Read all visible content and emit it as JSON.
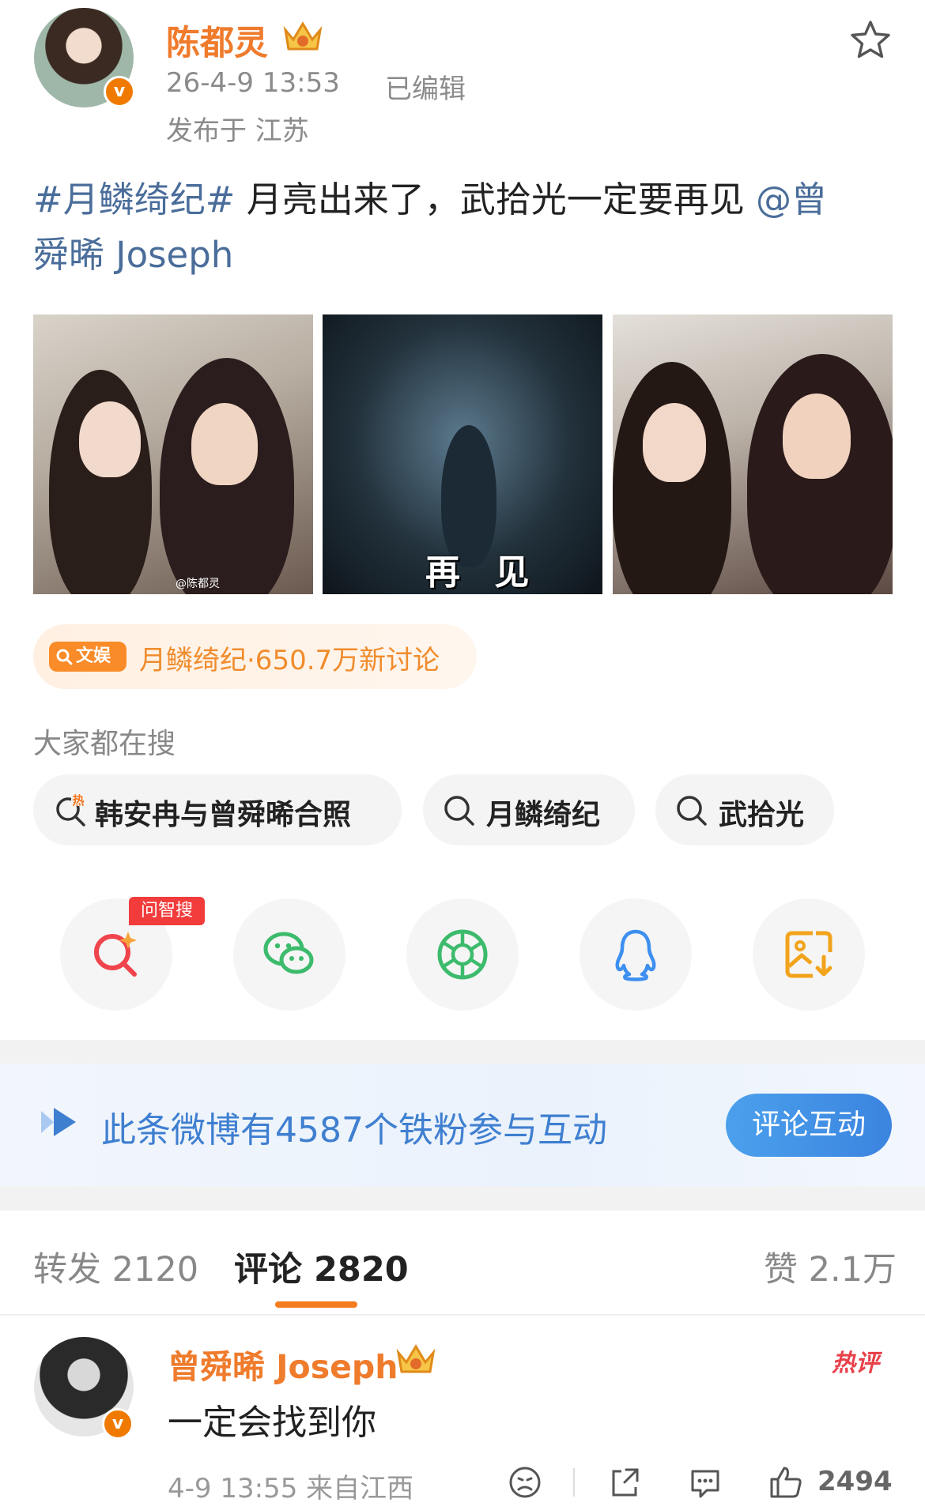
{
  "post": {
    "author": "陈都灵",
    "time": "26-4-9 13:53",
    "edited": "已编辑",
    "location": "发布于 江苏",
    "hashtag": "#月鳞绮纪#",
    "text": " 月亮出来了，武拾光一定要再见 ",
    "mention_line1": "@曾",
    "mention_line2": "舜晞 Joseph",
    "image_watermark": "@陈都灵",
    "image_caption": "再 见"
  },
  "topic": {
    "tag": "文娱",
    "text": "月鳞绮纪·650.7万新讨论"
  },
  "search": {
    "title": "大家都在搜",
    "chips": [
      {
        "label": "韩安冉与曾舜晞合照",
        "icon": "hot-search-icon"
      },
      {
        "label": "月鳞绮纪",
        "icon": "search-icon"
      },
      {
        "label": "武拾光",
        "icon": "search-icon"
      }
    ]
  },
  "share": {
    "wzs_badge": "问智搜",
    "buttons": [
      "ask-search-icon",
      "wechat-icon",
      "moments-icon",
      "qq-icon",
      "save-image-icon"
    ]
  },
  "fans": {
    "text": "此条微博有4587个铁粉参与互动",
    "button": "评论互动"
  },
  "tabs": {
    "repost_label": "转发",
    "repost_count": "2120",
    "comment_label": "评论",
    "comment_count": "2820",
    "like_label": "赞",
    "like_count": "2.1万"
  },
  "comment": {
    "author": "曾舜晞 Joseph",
    "badge": "热评",
    "text": "一定会找到你",
    "time": "4-9 13:55 来自江西",
    "likes": "2494"
  },
  "colors": {
    "accent_orange": "#ef7b2c",
    "link_blue": "#4a6d9a",
    "fan_blue": "#3f7fd0"
  }
}
